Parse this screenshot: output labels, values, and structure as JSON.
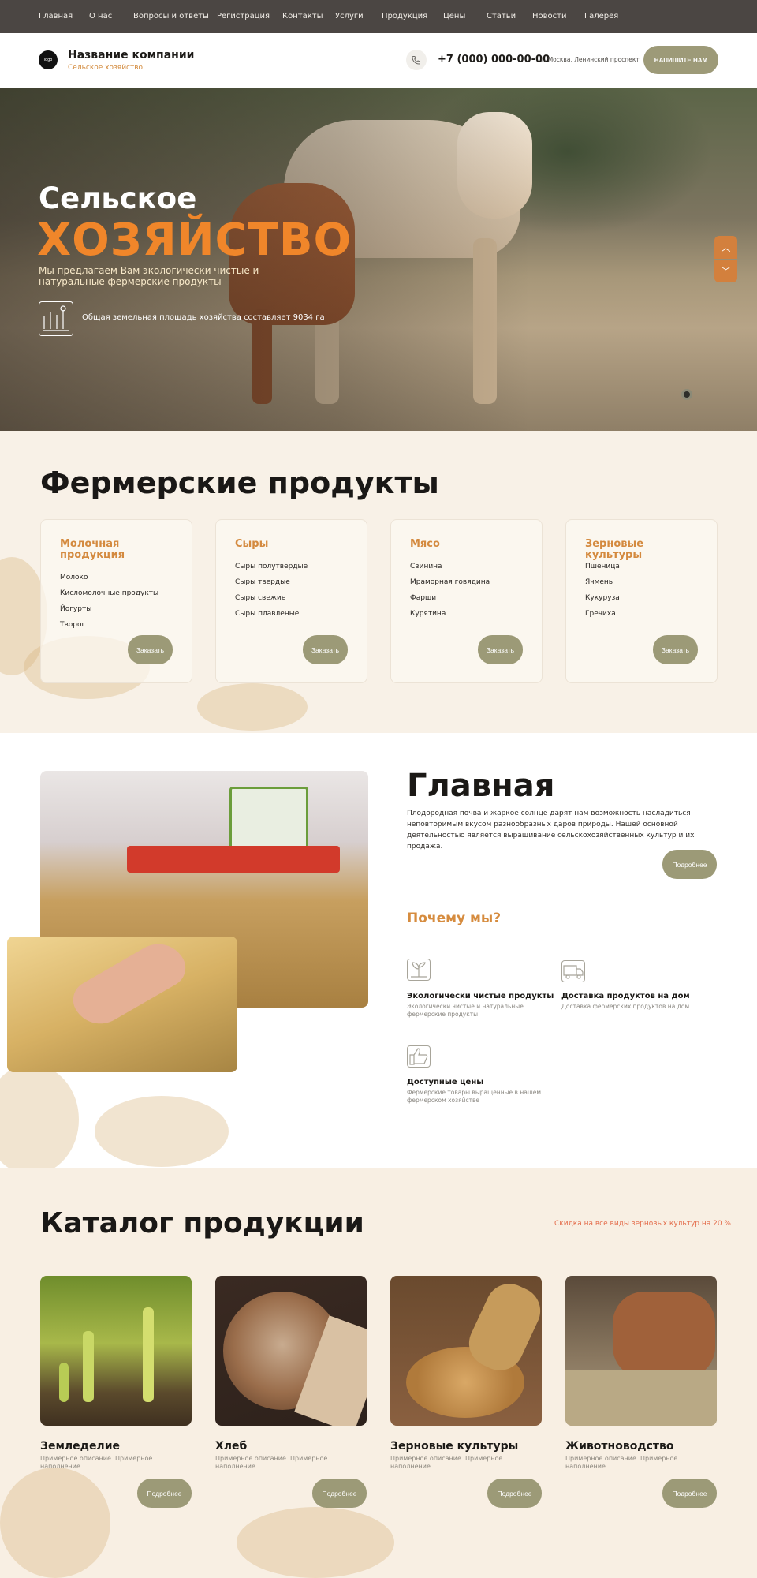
{
  "nav": {
    "items": [
      "Главная",
      "О нас",
      "Вопросы и ответы",
      "Регистрация",
      "Контакты",
      "Услуги",
      "Продукция",
      "Цены",
      "Статьи",
      "Новости",
      "Галерея"
    ]
  },
  "header": {
    "logo_text": "logo",
    "company_name": "Название компании",
    "company_sub": "Сельское хозяйство",
    "phone": "+7 (000) 000-00-00",
    "address": "г. Москва, Ленинский проспект",
    "write_button": "НАПИШИТЕ НАМ"
  },
  "hero": {
    "title_line1": "Сельское",
    "title_line2": "ХОЗЯЙСТВО",
    "description": "Мы предлагаем Вам экологически чистые и натуральные фермерские продукты",
    "area_text": "Общая земельная площадь хозяйства составляет 9034 га",
    "slider_up": "︿",
    "slider_down": "﹀"
  },
  "products": {
    "title": "Фермерские продукты",
    "order_label": "Заказать",
    "cards": [
      {
        "title": "Молочная продукция",
        "items": [
          "Молоко",
          "Кисломолочные продукты",
          "Йогурты",
          "Творог"
        ]
      },
      {
        "title": "Сыры",
        "items": [
          "Сыры полутвердые",
          "Сыры твердые",
          "Сыры свежие",
          "Сыры плавленые"
        ]
      },
      {
        "title": "Мясо",
        "items": [
          "Свинина",
          "Мраморная говядина",
          "Фарши",
          "Курятина"
        ]
      },
      {
        "title": "Зерновые культуры",
        "items": [
          "Пшеница",
          "Ячмень",
          "Кукуруза",
          "Гречиха"
        ]
      }
    ]
  },
  "main": {
    "title": "Главная",
    "text": "Плодородная почва и жаркое солнце дарят нам возможность насладиться неповторимым вкусом разнообразных даров природы. Нашей основной деятельностью является выращивание сельскохозяйственных культур и их продажа.",
    "more_label": "Подробнее",
    "why_title": "Почему мы?",
    "features": [
      {
        "icon": "eco-plant-icon",
        "title": "Экологически чистые продукты",
        "desc": "Экологически чистые и натуральные фермерские продукты"
      },
      {
        "icon": "delivery-truck-icon",
        "title": "Доставка продуктов на дом",
        "desc": "Доставка фермерских продуктов на дом"
      },
      {
        "icon": "thumbs-up-icon",
        "title": "Доступные цены",
        "desc": "Фермерские товары выращенные в нашем фермерском хозяйстве"
      }
    ]
  },
  "catalog": {
    "title": "Каталог продукции",
    "discount": "Скидка на все виды зерновых культур на 20 %",
    "more_label": "Подробнее",
    "items": [
      {
        "title": "Земледелие",
        "desc": "Примерное описание. Примерное наполнение"
      },
      {
        "title": "Хлеб",
        "desc": "Примерное описание. Примерное наполнение"
      },
      {
        "title": "Зерновые культуры",
        "desc": "Примерное описание. Примерное наполнение"
      },
      {
        "title": "Животноводство",
        "desc": "Примерное описание. Примерное наполнение"
      }
    ]
  },
  "colors": {
    "accent_orange": "#f0862a",
    "olive_button": "#9c9a77",
    "nav_bg": "#4b4643"
  }
}
